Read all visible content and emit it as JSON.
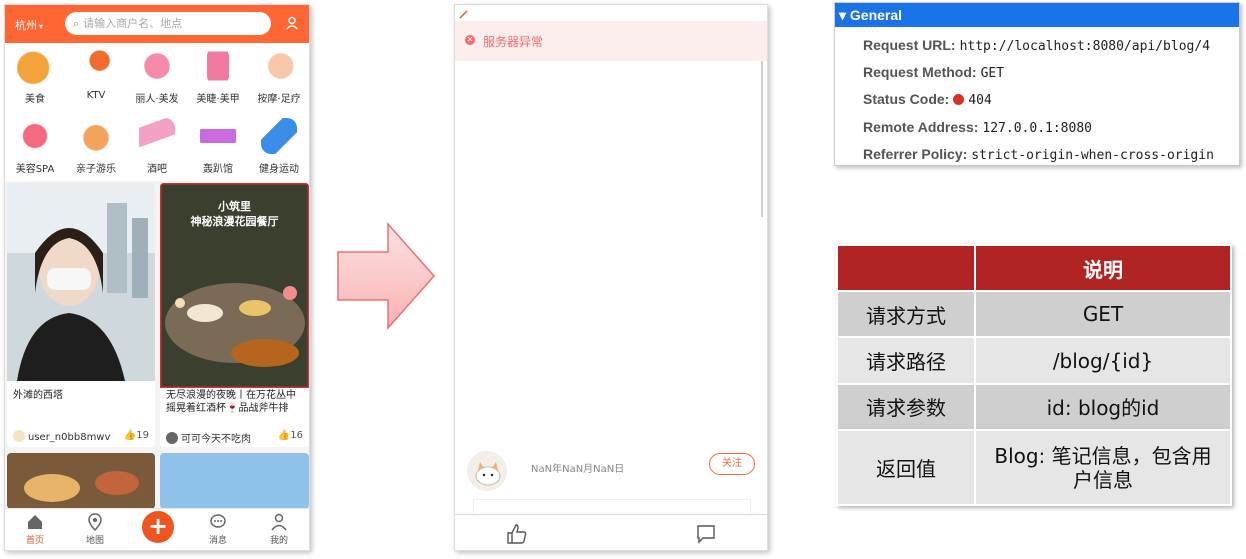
{
  "app_left": {
    "city": "杭州",
    "search_placeholder": "请输入商户名、地点",
    "categories": [
      {
        "label": "美食",
        "color": "#f4a23a"
      },
      {
        "label": "KTV",
        "color": "#ef6b2f"
      },
      {
        "label": "丽人·美发",
        "color": "#f48ba8"
      },
      {
        "label": "美睫·美甲",
        "color": "#f07aa0"
      },
      {
        "label": "按摩·足疗",
        "color": "#f6c7a8"
      },
      {
        "label": "美容SPA",
        "color": "#f46a7e"
      },
      {
        "label": "亲子游乐",
        "color": "#f3a35b"
      },
      {
        "label": "酒吧",
        "color": "#f2a0c4"
      },
      {
        "label": "轰趴馆",
        "color": "#c86be0"
      },
      {
        "label": "健身运动",
        "color": "#3b8de8"
      }
    ],
    "feed": [
      {
        "title": "外滩的西塔",
        "user": "user_n0bb8mwv",
        "likes": "19"
      },
      {
        "title": "无尽浪漫的夜晚丨在万花丛中摇晃着红酒杯🍷品战斧牛排",
        "image_text": "小筑里\n神秘浪漫花园餐厅",
        "user": "可可今天不吃肉",
        "likes": "16"
      }
    ],
    "tabs": [
      "首页",
      "地图",
      "消息",
      "我的"
    ]
  },
  "app_right": {
    "error_message": "服务器异常",
    "author_info": "NaN年NaN月NaN日",
    "follow_label": "关注"
  },
  "general": {
    "title": "General",
    "rows": [
      {
        "key": "Request URL:",
        "value": "http://localhost:8080/api/blog/4"
      },
      {
        "key": "Request Method:",
        "value": "GET"
      },
      {
        "key": "Status Code:",
        "value": "404",
        "status_color": "#d93025"
      },
      {
        "key": "Remote Address:",
        "value": "127.0.0.1:8080"
      },
      {
        "key": "Referrer Policy:",
        "value": "strict-origin-when-cross-origin"
      }
    ]
  },
  "table": {
    "header": [
      "",
      "说明"
    ],
    "rows": [
      [
        "请求方式",
        "GET"
      ],
      [
        "请求路径",
        "/blog/{id}"
      ],
      [
        "请求参数",
        "id: blog的id"
      ],
      [
        "返回值",
        "Blog: 笔记信息，包含用户信息"
      ]
    ]
  },
  "colors": {
    "brand": "#ff6633",
    "header_red": "#b12424",
    "general_blue": "#1a73e8"
  }
}
